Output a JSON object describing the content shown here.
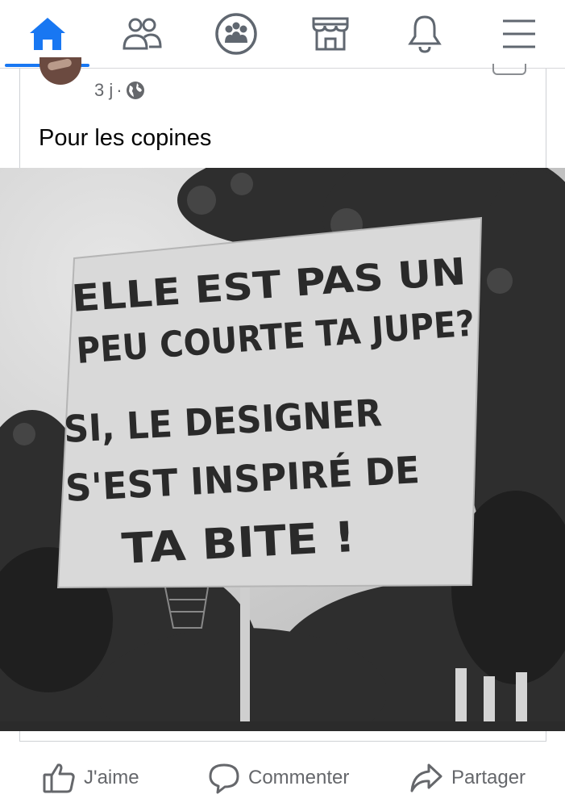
{
  "nav": {
    "items": [
      {
        "icon": "home-icon",
        "active": true
      },
      {
        "icon": "friends-icon",
        "active": false
      },
      {
        "icon": "groups-icon",
        "active": false
      },
      {
        "icon": "marketplace-icon",
        "active": false
      },
      {
        "icon": "notifications-bell-icon",
        "active": false
      },
      {
        "icon": "menu-icon",
        "active": false
      }
    ],
    "accent_color": "#1877f2",
    "icon_color": "#606770"
  },
  "post": {
    "timestamp": "3 j",
    "separator": "·",
    "audience_icon": "globe-icon",
    "text": "Pour les copines",
    "sign": {
      "lines": [
        "ELLE EST  PAS UN",
        "PEU COURTE TA JUPE?",
        "SI, LE DESIGNER",
        "S'EST INSPIRÉ DE",
        "TA BITE !"
      ]
    }
  },
  "actions": {
    "like_label": "J'aime",
    "comment_label": "Commenter",
    "share_label": "Partager"
  }
}
